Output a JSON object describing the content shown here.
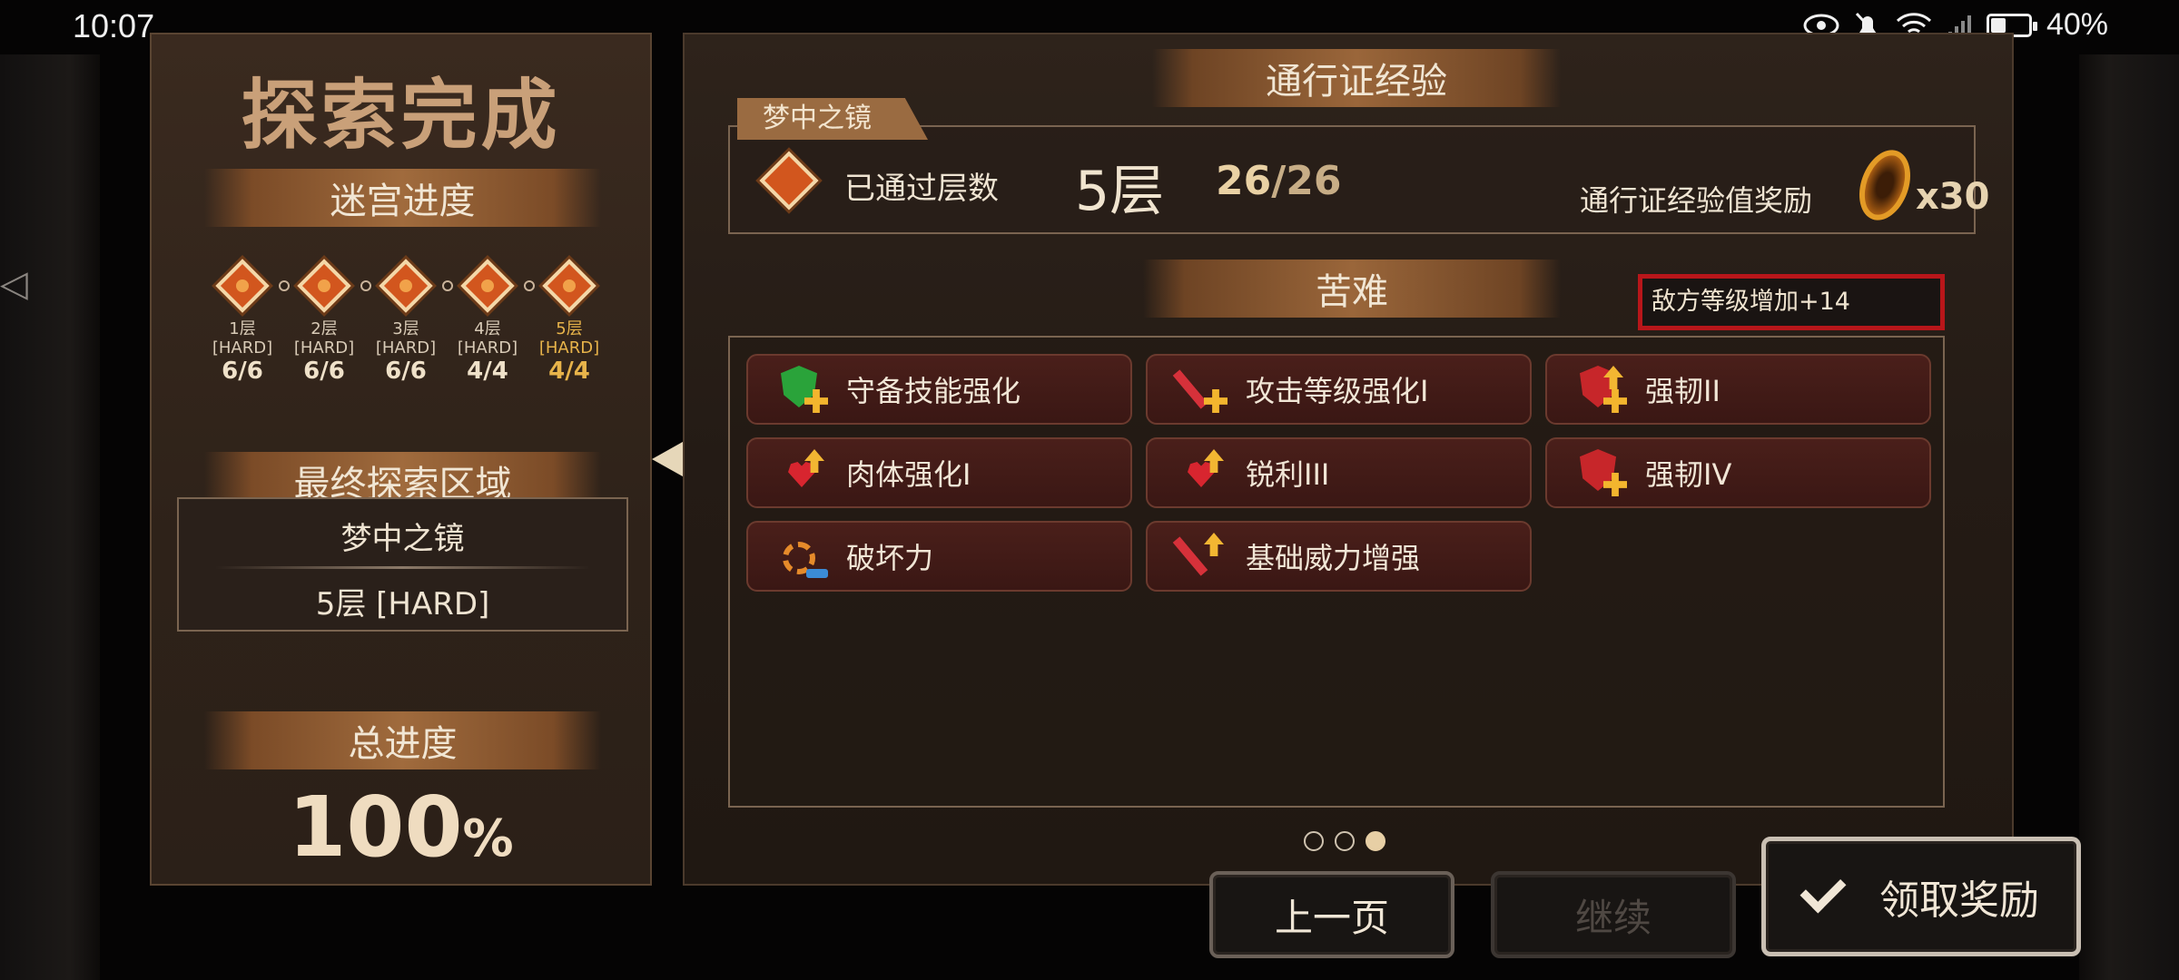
{
  "status_bar": {
    "time": "10:07",
    "battery": "40%",
    "battery_level": 0.4
  },
  "left": {
    "title": "探索完成",
    "maze_progress_label": "迷宫进度",
    "floors": [
      {
        "name": "1层",
        "difficulty": "[HARD]",
        "count": "6/6"
      },
      {
        "name": "2层",
        "difficulty": "[HARD]",
        "count": "6/6"
      },
      {
        "name": "3层",
        "difficulty": "[HARD]",
        "count": "6/6"
      },
      {
        "name": "4层",
        "difficulty": "[HARD]",
        "count": "4/4"
      },
      {
        "name": "5层",
        "difficulty": "[HARD]",
        "count": "4/4"
      }
    ],
    "final_area_label": "最终探索区域",
    "final_area_name": "梦中之镜",
    "final_area_floor": "5层 [HARD]",
    "total_progress_label": "总进度",
    "total_progress_value": "100",
    "total_progress_unit": "%"
  },
  "right": {
    "pass_exp_title": "通行证经验",
    "map_tag": "梦中之镜",
    "passed_floors_label": "已通过层数",
    "passed_floor": "5层",
    "passed_count_current": "26",
    "passed_count_total": "/26",
    "pass_reward_label": "通行证经验值奖励",
    "pass_reward_count": "x30",
    "hardship_title": "苦难",
    "enemy_level_text": "敌方等级增加+14",
    "hardships": [
      {
        "label": "守备技能强化",
        "icon": "shield-green-plus-icon"
      },
      {
        "label": "攻击等级强化I",
        "icon": "sword-plus-icon"
      },
      {
        "label": "强韧II",
        "icon": "shield-arrow-icon"
      },
      {
        "label": "肉体强化I",
        "icon": "heart-arrow-icon"
      },
      {
        "label": "锐利III",
        "icon": "sword-heart-icon"
      },
      {
        "label": "强韧IV",
        "icon": "shield-plus-icon"
      },
      {
        "label": "破坏力",
        "icon": "gear-break-icon"
      },
      {
        "label": "基础威力增强",
        "icon": "sword-arrow-icon"
      }
    ],
    "page_count": 3,
    "active_page": 3
  },
  "buttons": {
    "prev_label": "上一页",
    "next_label": "继续",
    "claim_label": "领取奖励"
  },
  "colors": {
    "accent_gold": "#e8b44a",
    "enemy_border": "#b8161a",
    "panel_bg": "#2e2219"
  }
}
